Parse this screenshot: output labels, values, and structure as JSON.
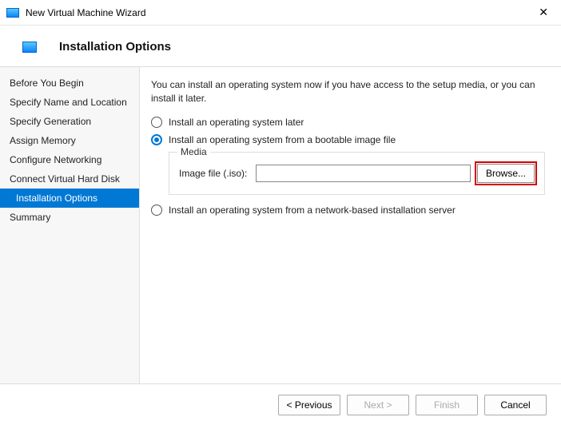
{
  "window": {
    "title": "New Virtual Machine Wizard"
  },
  "header": {
    "title": "Installation Options"
  },
  "sidebar": {
    "items": [
      {
        "label": "Before You Begin"
      },
      {
        "label": "Specify Name and Location"
      },
      {
        "label": "Specify Generation"
      },
      {
        "label": "Assign Memory"
      },
      {
        "label": "Configure Networking"
      },
      {
        "label": "Connect Virtual Hard Disk"
      },
      {
        "label": "Installation Options"
      },
      {
        "label": "Summary"
      }
    ]
  },
  "content": {
    "description": "You can install an operating system now if you have access to the setup media, or you can install it later.",
    "option_later": "Install an operating system later",
    "option_image": "Install an operating system from a bootable image file",
    "option_network": "Install an operating system from a network-based installation server",
    "media": {
      "legend": "Media",
      "label": "Image file (.iso):",
      "value": "",
      "browse": "Browse..."
    }
  },
  "footer": {
    "previous": "< Previous",
    "next": "Next >",
    "finish": "Finish",
    "cancel": "Cancel"
  }
}
